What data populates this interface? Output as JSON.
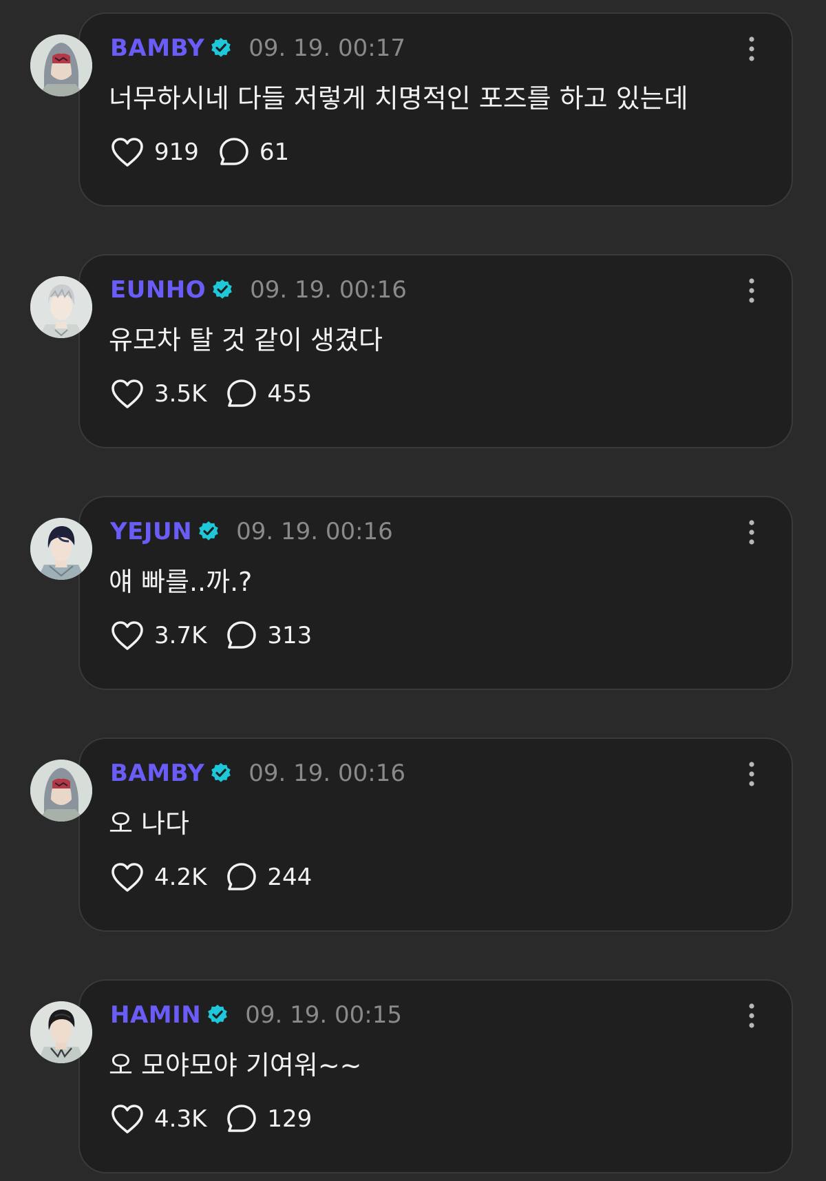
{
  "colors": {
    "background": "#2a2a2b",
    "card": "#1f1f20",
    "card_border": "#3a3a3c",
    "username": "#6a5cf6",
    "verified_badge": "#1fc8d8",
    "timestamp": "#8a8a8d",
    "text": "#f2f2f2"
  },
  "posts": [
    {
      "username": "BAMBY",
      "verified": true,
      "timestamp": "09. 19. 00:17",
      "content": "너무하시네 다들 저렇게 치명적인 포즈를 하고 있는데",
      "likes": "919",
      "replies": "61",
      "avatar_icon": "hooded-character-avatar"
    },
    {
      "username": "EUNHO",
      "verified": true,
      "timestamp": "09. 19. 00:16",
      "content": "유모차 탈 것 같이 생겼다",
      "likes": "3.5K",
      "replies": "455",
      "avatar_icon": "silver-hair-character-avatar"
    },
    {
      "username": "YEJUN",
      "verified": true,
      "timestamp": "09. 19. 00:16",
      "content": "얘 빠를..까.?",
      "likes": "3.7K",
      "replies": "313",
      "avatar_icon": "dark-hair-character-avatar"
    },
    {
      "username": "BAMBY",
      "verified": true,
      "timestamp": "09. 19. 00:16",
      "content": "오 나다",
      "likes": "4.2K",
      "replies": "244",
      "avatar_icon": "hooded-character-avatar"
    },
    {
      "username": "HAMIN",
      "verified": true,
      "timestamp": "09. 19. 00:15",
      "content": "오 모야모야 기여워~~",
      "likes": "4.3K",
      "replies": "129",
      "avatar_icon": "black-hair-character-avatar"
    }
  ]
}
